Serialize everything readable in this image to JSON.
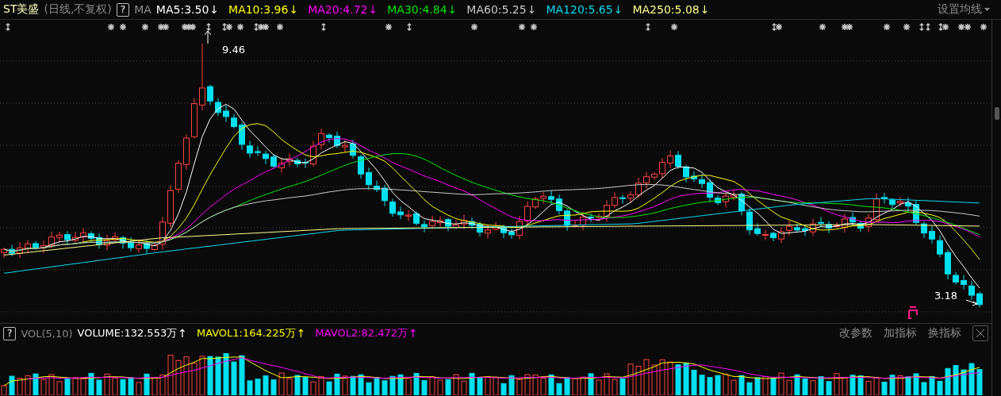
{
  "title": {
    "name": "ST美盛",
    "period": "(日线,不复权)",
    "help": "?",
    "indicator": "MA"
  },
  "ma_values": [
    {
      "label": "MA5:3.50",
      "color": "#ffffff",
      "arrow": "↓"
    },
    {
      "label": "MA10:3.96",
      "color": "#ffff00",
      "arrow": "↓"
    },
    {
      "label": "MA20:4.72",
      "color": "#ff00ff",
      "arrow": "↓"
    },
    {
      "label": "MA30:4.84",
      "color": "#00e600",
      "arrow": "↓"
    },
    {
      "label": "MA60:5.25",
      "color": "#c8c8c8",
      "arrow": "↓"
    },
    {
      "label": "MA120:5.65",
      "color": "#00d8f0",
      "arrow": "↓"
    },
    {
      "label": "MA250:5.08",
      "color": "#ffff90",
      "arrow": "↓"
    }
  ],
  "settings_menu": "设置均线",
  "price_chart": {
    "high_label": "9.46",
    "low_label": "3.18"
  },
  "volume": {
    "help": "?",
    "indicator": "VOL(5,10)",
    "values": [
      {
        "label": "VOLUME:132.553万",
        "color": "#ffffff",
        "arrow": "↑"
      },
      {
        "label": "MAVOL1:164.225万",
        "color": "#ffff00",
        "arrow": "↑"
      },
      {
        "label": "MAVOL2:82.472万",
        "color": "#ff00ff",
        "arrow": "↑"
      }
    ],
    "buttons": [
      "改参数",
      "加指标",
      "换指标"
    ]
  }
}
